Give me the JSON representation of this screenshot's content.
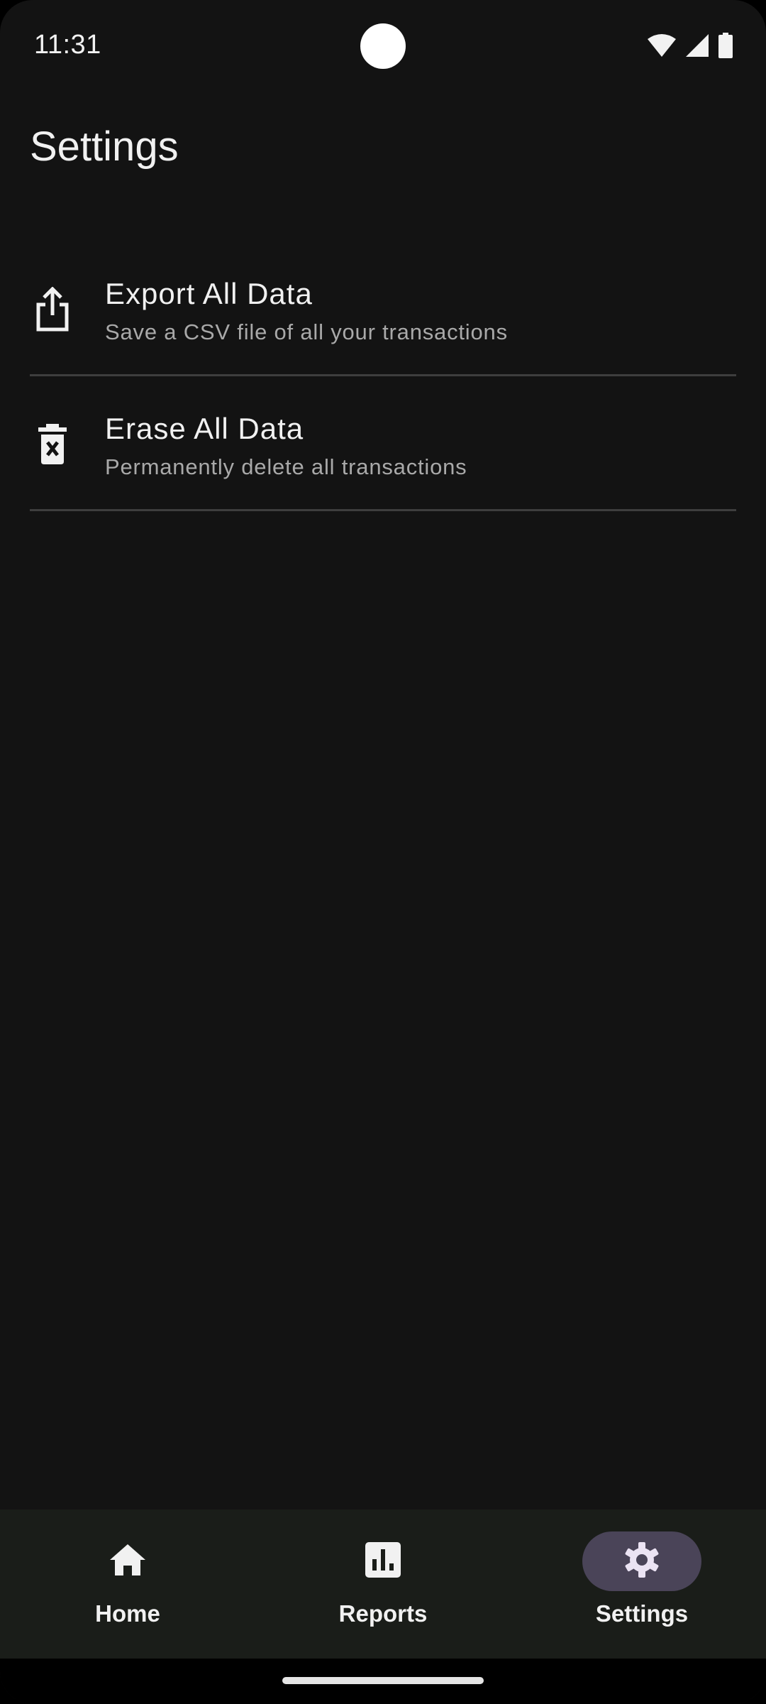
{
  "status_bar": {
    "time": "11:31",
    "icons": [
      "wifi-icon",
      "signal-icon",
      "battery-icon"
    ]
  },
  "page": {
    "title": "Settings"
  },
  "settings": {
    "items": [
      {
        "icon": "share-export-icon",
        "title": "Export All Data",
        "subtitle": "Save a CSV file of all your transactions"
      },
      {
        "icon": "delete-forever-icon",
        "title": "Erase All Data",
        "subtitle": "Permanently delete all transactions"
      }
    ]
  },
  "bottom_nav": {
    "items": [
      {
        "icon": "home-icon",
        "label": "Home",
        "active": false
      },
      {
        "icon": "bar-chart-icon",
        "label": "Reports",
        "active": false
      },
      {
        "icon": "gear-icon",
        "label": "Settings",
        "active": true
      }
    ]
  },
  "colors": {
    "background": "#131313",
    "nav_background": "#1a1d19",
    "active_indicator": "#4a4458",
    "divider": "#3e3e3e",
    "text_primary": "#f1f1f1",
    "text_secondary": "#a9a9a9"
  }
}
